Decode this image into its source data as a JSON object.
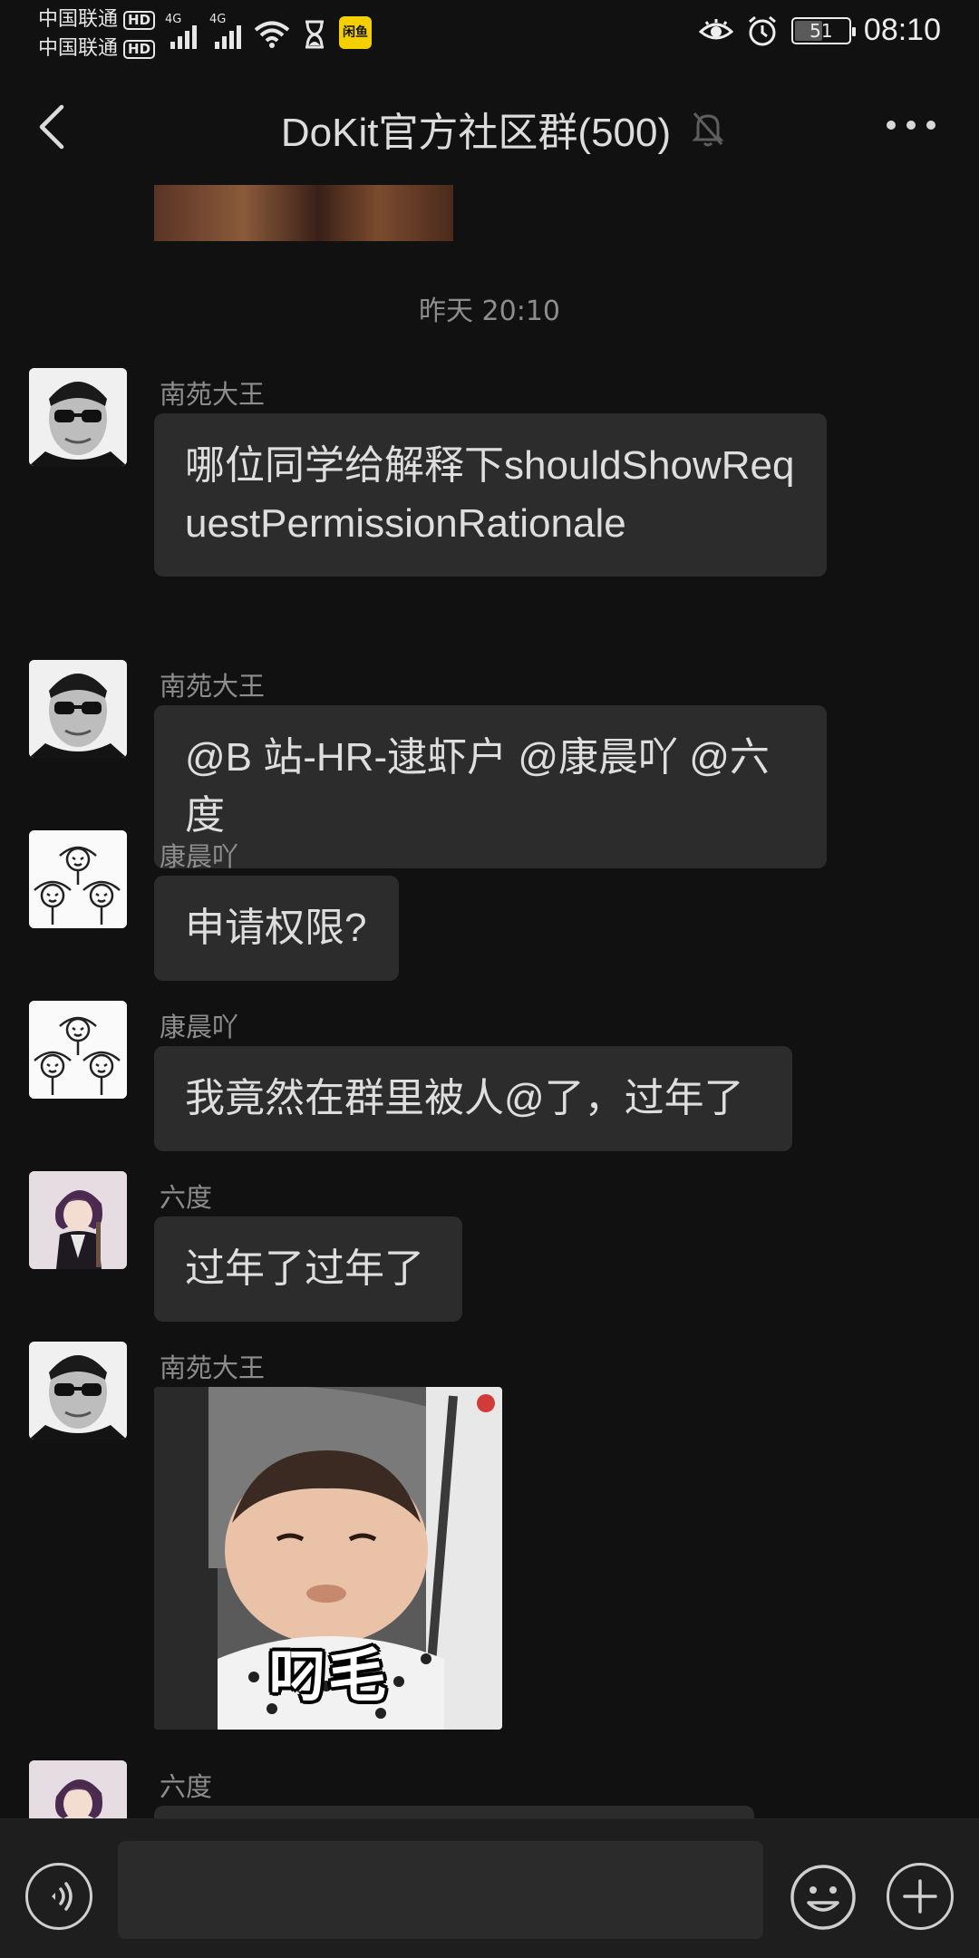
{
  "status_bar": {
    "carrier_1": "中国联通",
    "carrier_2": "中国联通",
    "hd_label": "HD",
    "network_1": "4G",
    "network_2": "4G",
    "app_badge": "闲鱼",
    "battery_level": "51",
    "battery_fraction": 0.51,
    "time": "08:10",
    "icons": [
      "eye-comfort-icon",
      "alarm-icon",
      "hourglass-icon",
      "wifi-icon"
    ]
  },
  "nav": {
    "title": "DoKit官方社区群(500)",
    "muted_icon": "bell-off-icon",
    "back_icon": "chevron-left-icon",
    "more_icon": "more-dots-icon"
  },
  "chat": {
    "timestamp": "昨天 20:10",
    "messages": [
      {
        "sender": "南苑大王",
        "type": "text",
        "text": "哪位同学给解释下shouldShowRequestPermissionRationale",
        "avatar": "sunglasses-man"
      },
      {
        "sender": "南苑大王",
        "type": "text",
        "text": "@B 站-HR-逮虾户 @康晨吖 @六度",
        "avatar": "sunglasses-man"
      },
      {
        "sender": "康晨吖",
        "type": "text",
        "text": "申请权限?",
        "avatar": "sketch-flowers"
      },
      {
        "sender": "康晨吖",
        "type": "text",
        "text": "我竟然在群里被人@了，过年了",
        "avatar": "sketch-flowers"
      },
      {
        "sender": "六度",
        "type": "text",
        "text": "过年了过年了",
        "avatar": "anime-character"
      },
      {
        "sender": "南苑大王",
        "type": "sticker",
        "caption": "叼毛",
        "avatar": "sunglasses-man"
      },
      {
        "sender": "六度",
        "type": "text",
        "text": "",
        "avatar": "anime-character"
      }
    ]
  },
  "input_bar": {
    "placeholder": "",
    "voice_icon": "voice-icon",
    "emoji_icon": "emoji-icon",
    "plus_icon": "plus-icon"
  }
}
